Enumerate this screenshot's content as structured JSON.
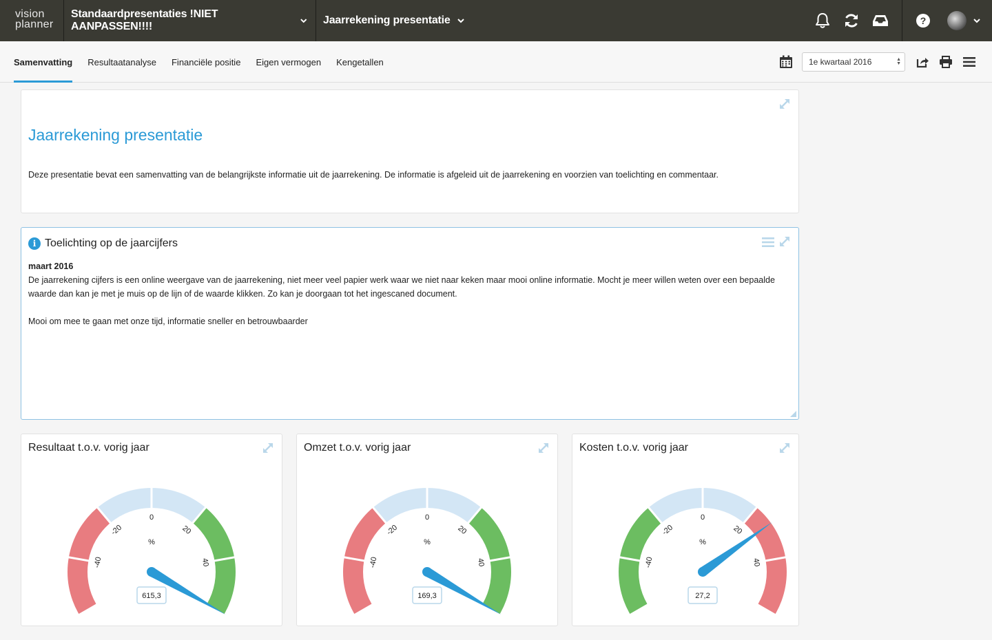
{
  "app": {
    "logo_line1": "vision",
    "logo_line2": "planner"
  },
  "topbar": {
    "presentation_group": "Standaardpresentaties !NIET AANPASSEN!!!!",
    "presentation": "Jaarrekening presentatie",
    "icons": [
      "bell-icon",
      "refresh-icon",
      "inbox-icon",
      "help-icon",
      "avatar",
      "chevron-down-icon"
    ]
  },
  "subnav": {
    "tabs": [
      {
        "label": "Samenvatting",
        "active": true
      },
      {
        "label": "Resultaatanalyse",
        "active": false
      },
      {
        "label": "Financiële positie",
        "active": false
      },
      {
        "label": "Eigen vermogen",
        "active": false
      },
      {
        "label": "Kengetallen",
        "active": false
      }
    ],
    "period_select": "1e kwartaal 2016",
    "icons": [
      "calendar-icon",
      "share-icon",
      "print-icon",
      "hamburger-menu-icon"
    ]
  },
  "intro": {
    "title": "Jaarrekening presentatie",
    "text": "Deze presentatie bevat een samenvatting van de belangrijkste informatie uit de jaarrekening. De informatie is afgeleid uit de jaarrekening en voorzien van toelichting en commentaar."
  },
  "note": {
    "title": "Toelichting op de jaarcijfers",
    "date": "maart 2016",
    "para1": "De jaarrekening cijfers is een online weergave van de jaarrekening, niet meer veel papier werk waar we niet naar keken maar mooi online informatie. Mocht je meer willen weten over een bepaalde waarde dan kan je met je muis op de lijn of de waarde klikken. Zo kan je doorgaan tot het ingescaned document.",
    "para2": "Mooi om mee te gaan met onze tijd, informatie sneller en betrouwbaarder"
  },
  "gauges": [
    {
      "title": "Resultaat t.o.v. vorig jaar",
      "value_label": "615,3",
      "unit": "%",
      "needle_value": 615.3,
      "min": -60,
      "max": 60,
      "ticks": [
        "-40",
        "-20",
        "0",
        "20",
        "40"
      ],
      "bands": [
        {
          "from": -60,
          "to": -20,
          "color": "#e87c80"
        },
        {
          "from": -20,
          "to": 20,
          "color": "#d3e6f5"
        },
        {
          "from": 20,
          "to": 60,
          "color": "#6cbd61"
        }
      ]
    },
    {
      "title": "Omzet t.o.v. vorig jaar",
      "value_label": "169,3",
      "unit": "%",
      "needle_value": 169.3,
      "min": -60,
      "max": 60,
      "ticks": [
        "-40",
        "-20",
        "0",
        "20",
        "40"
      ],
      "bands": [
        {
          "from": -60,
          "to": -20,
          "color": "#e87c80"
        },
        {
          "from": -20,
          "to": 20,
          "color": "#d3e6f5"
        },
        {
          "from": 20,
          "to": 60,
          "color": "#6cbd61"
        }
      ]
    },
    {
      "title": "Kosten t.o.v. vorig jaar",
      "value_label": "27,2",
      "unit": "%",
      "needle_value": 27.2,
      "min": -60,
      "max": 60,
      "ticks": [
        "-40",
        "-20",
        "0",
        "20",
        "40"
      ],
      "bands": [
        {
          "from": -60,
          "to": -20,
          "color": "#6cbd61"
        },
        {
          "from": -20,
          "to": 20,
          "color": "#d3e6f5"
        },
        {
          "from": 20,
          "to": 60,
          "color": "#e87c80"
        }
      ]
    }
  ],
  "colors": {
    "accent": "#2b9ad6",
    "topbar": "#3a3a33",
    "needle": "#2b9ad6"
  }
}
